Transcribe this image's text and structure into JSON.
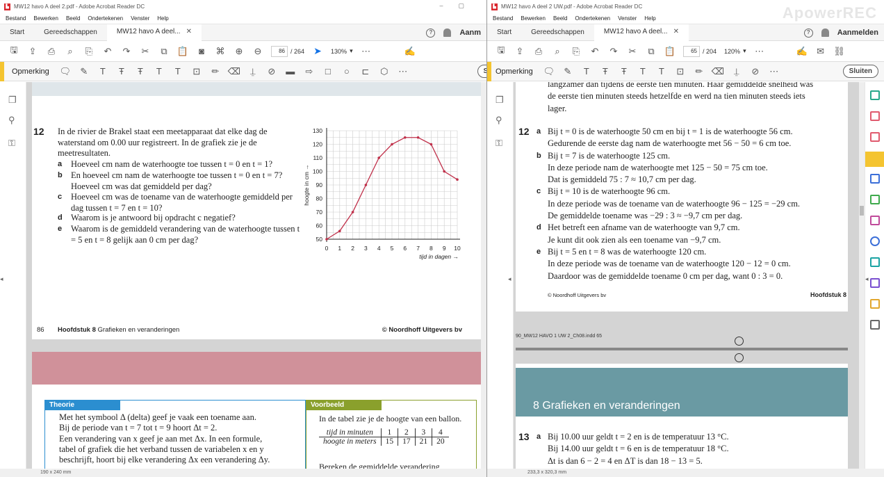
{
  "left": {
    "window_title": "MW12 havo A deel 2.pdf - Adobe Acrobat Reader DC",
    "menu": [
      "Bestand",
      "Bewerken",
      "Beeld",
      "Ondertekenen",
      "Venster",
      "Help"
    ],
    "tabs": {
      "start": "Start",
      "tools": "Gereedschappen",
      "doc": "MW12 havo A deel..."
    },
    "signin": "Aanm",
    "page_current": "86",
    "page_total": "/ 264",
    "zoom": "130%",
    "annot_label": "Opmerking",
    "close_btn": "Sl",
    "status": "190 x 240 mm",
    "question": {
      "number": "12",
      "intro": "In de rivier de Brakel staat een meetapparaat dat elke dag de waterstand om 0.00 uur registreert. In de grafiek zie je de meetresultaten.",
      "items": [
        {
          "label": "a",
          "text": "Hoeveel cm nam de waterhoogte toe tussen t = 0 en t = 1?"
        },
        {
          "label": "b",
          "text": "En hoeveel cm nam de waterhoogte toe tussen t = 0 en t = 7? Hoeveel cm was dat gemiddeld per dag?"
        },
        {
          "label": "c",
          "text": "Hoeveel cm was de toename van de waterhoogte gemiddeld per dag tussen t = 7 en t = 10?"
        },
        {
          "label": "d",
          "text": "Waarom is je antwoord bij opdracht c negatief?"
        },
        {
          "label": "e",
          "text": "Waarom is de gemiddeld verandering van de waterhoogte tussen t = 5 en t = 8 gelijk aan 0 cm per dag?"
        }
      ]
    },
    "footer": {
      "page": "86",
      "chapter_bold": "Hoofdstuk 8",
      "chapter": " Grafieken en veranderingen",
      "publisher": "© Noordhoff Uitgevers bv"
    },
    "theorie": {
      "title": "Theorie",
      "lines": [
        "Met het symbool Δ (delta) geef je vaak een toename aan.",
        "Bij de periode van t = 7 tot t = 9 hoort Δt = 2.",
        "Een verandering van x geef je aan met Δx. In een formule,",
        "tabel of grafiek die het verband tussen de variabelen x en y",
        "beschrijft, hoort bij elke verandering Δx een verandering Δy."
      ]
    },
    "voorbeeld": {
      "title": "Voorbeeld",
      "line1": "In de tabel zie je de hoogte van een ballon.",
      "table": {
        "row1": [
          "tijd in minuten",
          "1",
          "2",
          "3",
          "4"
        ],
        "row2": [
          "hoogte in meters",
          "15",
          "17",
          "21",
          "20"
        ]
      },
      "line2": "Bereken de gemiddelde verandering"
    }
  },
  "chart_data": {
    "type": "line",
    "x": [
      0,
      1,
      2,
      3,
      4,
      5,
      6,
      7,
      8,
      9,
      10
    ],
    "series": [
      {
        "values": [
          50,
          56,
          70,
          90,
          110,
          120,
          125,
          125,
          120,
          100,
          94
        ]
      }
    ],
    "xlabel": "tijd in dagen →",
    "ylabel": "hoogte in cm →",
    "xlim": [
      0,
      10
    ],
    "ylim": [
      50,
      130
    ],
    "yticks": [
      50,
      60,
      70,
      80,
      90,
      100,
      110,
      120,
      130
    ],
    "xticks": [
      0,
      1,
      2,
      3,
      4,
      5,
      6,
      7,
      8,
      9,
      10
    ],
    "grid": true,
    "color": "#c0304a"
  },
  "right": {
    "window_title": "MW12 havo A deel 2 UW.pdf - Adobe Acrobat Reader DC",
    "watermark": "ApowerREC",
    "menu": [
      "Bestand",
      "Bewerken",
      "Beeld",
      "Ondertekenen",
      "Venster",
      "Help"
    ],
    "tabs": {
      "start": "Start",
      "tools": "Gereedschappen",
      "doc": "MW12 havo A deel..."
    },
    "signin": "Aanmelden",
    "page_current": "65",
    "page_total": "/ 204",
    "zoom": "120%",
    "annot_label": "Opmerking",
    "close_btn": "Sluiten",
    "status": "233,3 x 320,3 mm",
    "top_lines": [
      "langzamer dan tijdens de eerste tien minuten. Haar gemiddelde snelheid was",
      "de eerste tien minuten steeds hetzelfde en werd na tien minuten steeds iets",
      "lager."
    ],
    "answer_number": "12",
    "answers": [
      {
        "label": "a",
        "lines": [
          "Bij t = 0 is de waterhoogte 50 cm en bij t = 1 is de waterhoogte 56 cm.",
          "Gedurende de eerste dag nam de waterhoogte met 56 − 50 = 6 cm toe."
        ]
      },
      {
        "label": "b",
        "lines": [
          "Bij t = 7 is de waterhoogte 125 cm.",
          "In deze periode nam de waterhoogte met 125 − 50 = 75 cm toe.",
          "Dat is gemiddeld 75 : 7 ≈ 10,7 cm per dag."
        ]
      },
      {
        "label": "c",
        "lines": [
          "Bij t = 10 is de waterhoogte 96 cm.",
          "In deze periode was de toename van de waterhoogte 96 − 125 = −29 cm.",
          "De gemiddelde toename was −29 : 3 ≈ −9,7 cm per dag."
        ]
      },
      {
        "label": "d",
        "lines": [
          "Het betreft een afname van de waterhoogte van 9,7 cm.",
          "Je kunt dit ook zien als een toename van −9,7 cm."
        ]
      },
      {
        "label": "e",
        "lines": [
          "Bij t = 5 en t = 8 was de waterhoogte 120 cm.",
          "In deze periode was de toename van de waterhoogte 120 − 12 = 0 cm.",
          "Daardoor was de gemiddelde toename 0 cm per dag, want 0 : 3 = 0."
        ]
      }
    ],
    "footer_left": "© Noordhoff Uitgevers bv",
    "footer_right": "Hoofdstuk 8",
    "indd": "90_MW12 HAVO 1 UW 2_Ch08.indd   65",
    "chapter_title": "8   Grafieken en veranderingen",
    "q13": {
      "number": "13",
      "label": "a",
      "lines": [
        "Bij 10.00 uur geldt t = 2 en is de temperatuur 13 °C.",
        "Bij 14.00 uur geldt t = 6 en is de temperatuur 18 °C.",
        "Δt is dan 6 − 2 = 4 en ΔT is dan 18 − 13 = 5."
      ]
    }
  }
}
